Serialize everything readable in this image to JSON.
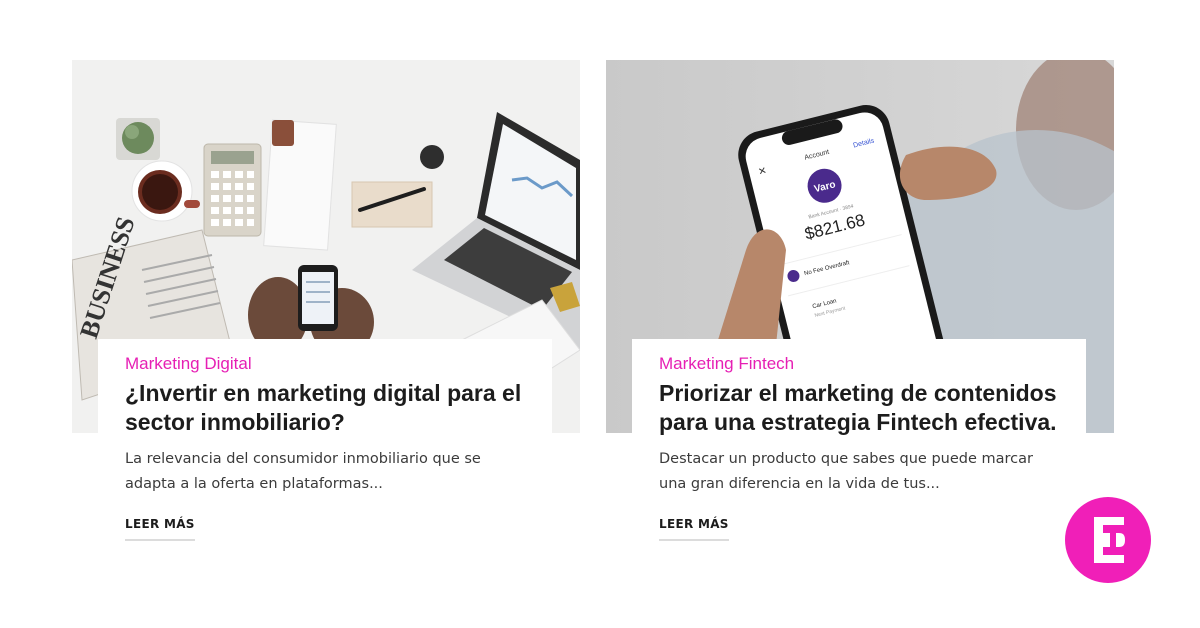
{
  "cards": [
    {
      "category": "Marketing Digital",
      "title": "¿Invertir en marketing digital para el sector inmobiliario?",
      "excerpt": "La relevancia del consumidor inmobiliario que se adapta a la oferta en plataformas...",
      "read_more": "LEER MÁS",
      "image": {
        "newspaper_text": "BUSINESS"
      }
    },
    {
      "category": "Marketing Fintech",
      "title": "Priorizar el marketing de contenidos para una estrategia Fintech efectiva.",
      "excerpt": "Destacar un producto que sabes que puede marcar una gran diferencia en la vida de tus...",
      "read_more": "LEER MÁS",
      "image": {
        "screen_header": "Account",
        "screen_action": "Details",
        "logo_text": "Varo",
        "account_label": "Bank Account · 3894",
        "balance": "$821.68",
        "item_1": "No Fee Overdraft",
        "item_2": "Car Loan",
        "item_2_sub": "Next Payment"
      }
    }
  ],
  "brand": {
    "logo_letter": "E",
    "color": "#f01fb8"
  },
  "colors": {
    "accent": "#e61fb4",
    "title": "#1c1c1c",
    "text": "#3b3b3b"
  }
}
